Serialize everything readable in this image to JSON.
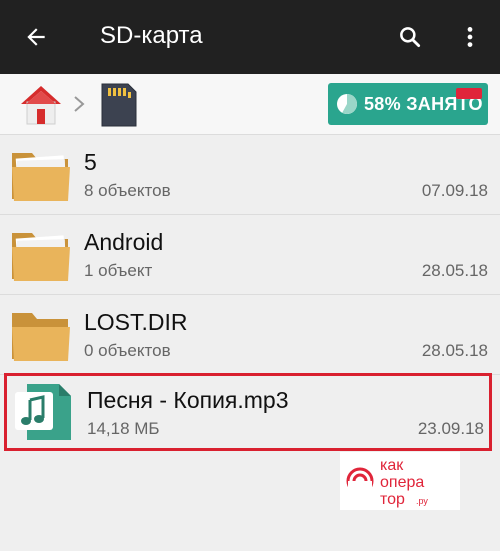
{
  "appbar": {
    "title": "SD-карта",
    "back_icon": "arrow-back-icon",
    "search_icon": "search-icon",
    "more_icon": "more-vert-icon"
  },
  "pathbar": {
    "home_icon": "home-icon",
    "separator_icon": "chevron-right-icon",
    "sd_icon": "sd-card-icon",
    "storage_label": "58% ЗАНЯТО",
    "storage_used_percent": 58
  },
  "files": [
    {
      "name": "5",
      "meta": "8 объектов",
      "date": "07.09.18",
      "type": "folder-with-files"
    },
    {
      "name": "Android",
      "meta": "1 объект",
      "date": "28.05.18",
      "type": "folder-with-files"
    },
    {
      "name": "LOST.DIR",
      "meta": "0 объектов",
      "date": "28.05.18",
      "type": "folder-empty"
    },
    {
      "name": "Песня - Копия.mp3",
      "meta": "14,18 МБ",
      "date": "23.09.18",
      "type": "audio-file"
    }
  ],
  "watermark": {
    "line1": "как",
    "line2": "опера",
    "line3": "тор",
    "suffix": ".ру"
  },
  "colors": {
    "appbar": "#212121",
    "accent": "#2aa58e",
    "highlight": "#d9202f",
    "folder": "#e9b45b"
  }
}
